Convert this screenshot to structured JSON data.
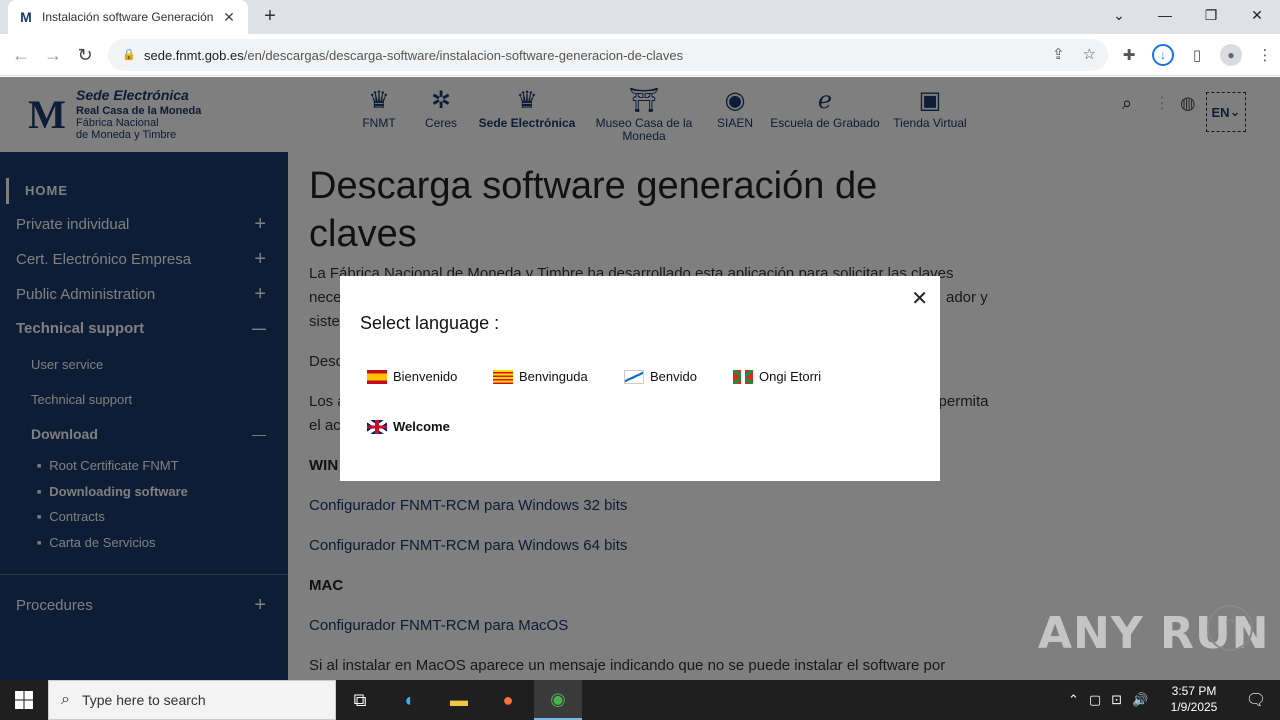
{
  "browser": {
    "tab_title": "Instalación software Generación",
    "url_domain": "sede.fnmt.gob.es",
    "url_path": "/en/descargas/descarga-software/instalacion-software-generacion-de-claves"
  },
  "header": {
    "logo_line1": "Sede Electrónica",
    "logo_line2": "Real Casa de la Moneda",
    "logo_line3": "Fábrica Nacional",
    "logo_line4": "de Moneda y Timbre",
    "nav": [
      {
        "label": "FNMT"
      },
      {
        "label": "Ceres"
      },
      {
        "label": "Sede Electrónica"
      },
      {
        "label": "Museo Casa de la Moneda"
      },
      {
        "label": "SIAEN"
      },
      {
        "label": "Escuela de Grabado"
      },
      {
        "label": "Tienda Virtual"
      }
    ],
    "lang": "EN"
  },
  "sidebar": {
    "home": "HOME",
    "items": [
      {
        "label": "Private individual",
        "sign": "+"
      },
      {
        "label": "Cert. Electrónico Empresa",
        "sign": "+"
      },
      {
        "label": "Public Administration",
        "sign": "+"
      },
      {
        "label": "Technical support",
        "sign": "—"
      }
    ],
    "sub": [
      "User service",
      "Technical support"
    ],
    "download": {
      "label": "Download",
      "sign": "—"
    },
    "bullets": [
      "Root Certificate FNMT",
      "Downloading software",
      "Contracts",
      "Carta de Servicios"
    ],
    "procedures": {
      "label": "Procedures",
      "sign": "+"
    }
  },
  "main": {
    "title": "Descarga software generación de claves",
    "para1a": "La Fábrica Nacional de Moneda y Timbre ha desarrollado esta aplicación para solicitar las claves",
    "para1b": "nece",
    "para1b_right": "ador y",
    "para1c": "siste",
    "para2": "Desc",
    "para3a": "Los a",
    "para3a_right": "e permita",
    "para3b": "el ac",
    "win_heading": "WIN",
    "link_win32": "Configurador FNMT-RCM para Windows 32 bits",
    "link_win64": "Configurador FNMT-RCM para Windows 64 bits",
    "mac_heading": "MAC",
    "link_mac": "Configurador FNMT-RCM para MacOS",
    "para_last": "Si al instalar en MacOS aparece un mensaje indicando que no se puede instalar el software por"
  },
  "modal": {
    "title": "Select language :",
    "options": [
      {
        "label": "Bienvenido"
      },
      {
        "label": "Benvinguda"
      },
      {
        "label": "Benvido"
      },
      {
        "label": "Ongi Etorri"
      },
      {
        "label": "Welcome"
      }
    ]
  },
  "watermark": "ANY RUN",
  "taskbar": {
    "search_placeholder": "Type here to search",
    "time": "3:57 PM",
    "date": "1/9/2025"
  }
}
